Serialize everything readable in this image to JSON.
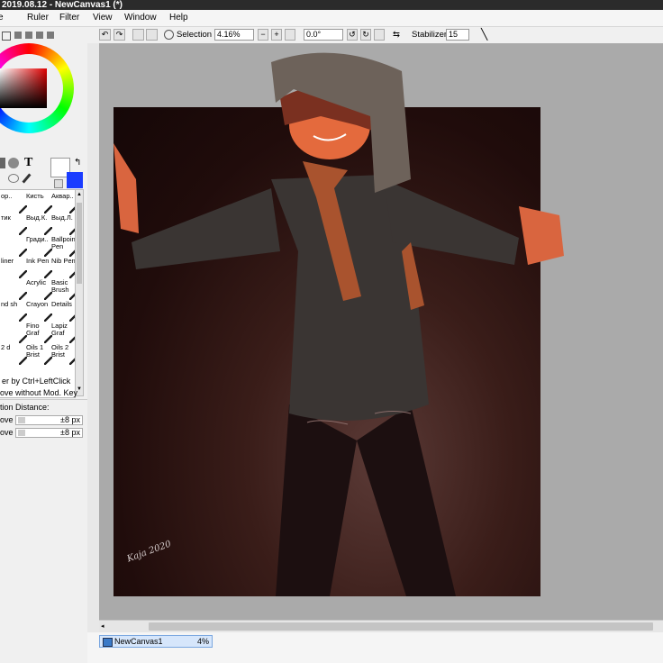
{
  "window": {
    "title": "2019.08.12 - NewCanvas1 (*)"
  },
  "menu": [
    "Ruler",
    "Filter",
    "View",
    "Window",
    "Help"
  ],
  "toolbar": {
    "selection_label": "Selection",
    "zoom": "4.16%",
    "rotation": "0.0°",
    "stabilizer_label": "Stabilizer",
    "stabilizer_value": "15"
  },
  "left_panel": {
    "brushes": [
      [
        "ор..",
        "Кисть",
        "Аквар.."
      ],
      [
        "тик",
        "Выд.К.",
        "Выд.Л."
      ],
      [
        "",
        "Гради..",
        "Ballpoint Pen"
      ],
      [
        "liner",
        "Ink Pen",
        "Nib Pen"
      ],
      [
        "",
        "Acrylic",
        "Basic Brush"
      ],
      [
        "nd sh",
        "Crayon",
        "Details"
      ],
      [
        "",
        "Fino Graf",
        "Lapiz Graf"
      ],
      [
        "2 d",
        "Oils 1 Brist",
        "Oils 2 Brist"
      ]
    ],
    "hint1": "er by Ctrl+LeftClick",
    "hint2": "ove without Mod. Key",
    "section_label": "tion Distance:",
    "row1_label": "ove",
    "row1_value": "±8 px",
    "row2_label": "ove",
    "row2_value": "±8 px"
  },
  "navigator": {
    "name": "NewCanvas1",
    "zoom": "4%"
  },
  "artwork": {
    "signature": "Kaja 2020"
  },
  "colors": {
    "primary": "#ffffff",
    "secondary": "#1a3cff"
  }
}
